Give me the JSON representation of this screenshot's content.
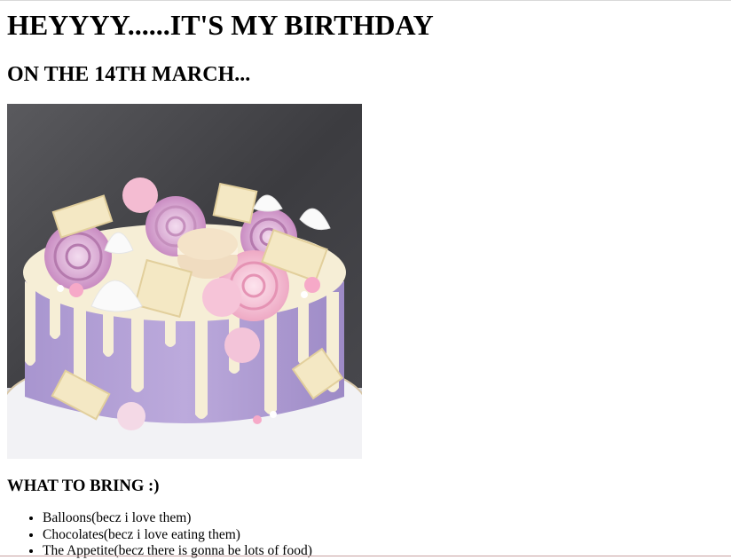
{
  "heading": "HEYYYY......IT'S MY BIRTHDAY",
  "subheading": "ON THE 14TH MARCH...",
  "image": {
    "subject": "cake-photo"
  },
  "bring_heading": "WHAT TO BRING :)",
  "bring_items": [
    "Balloons(becz i love them)",
    "Chocolates(becz i love eating them)",
    "The Appetite(becz there is gonna be lots of food)"
  ],
  "colors": {
    "cake_purple": "#b9a6d6",
    "icing_cream": "#f4ead0",
    "meringue_pink": "#e7b3cf",
    "backdrop_dark": "#3f3f42",
    "plate_white": "#eeeef2"
  }
}
